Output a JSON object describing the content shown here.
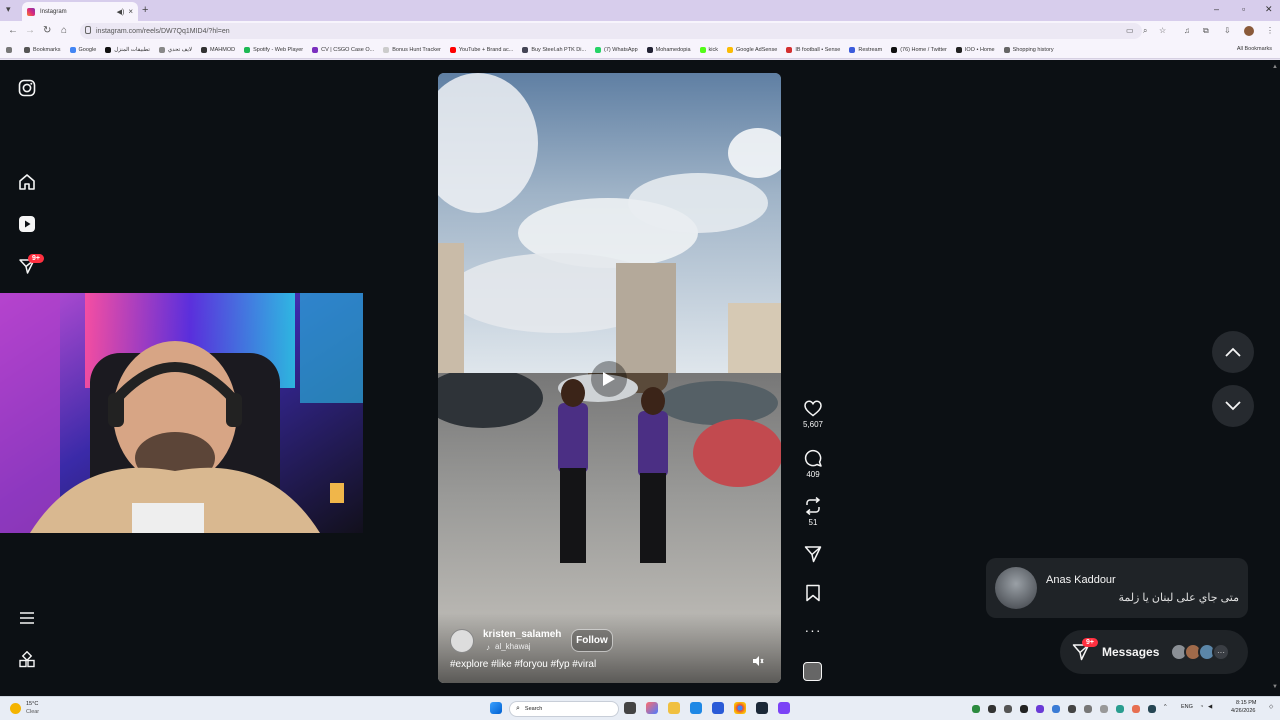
{
  "browser": {
    "tab_title": "Instagram",
    "url": "instagram.com/reels/DW7Qq1MID4/?hl=en",
    "bookmarks": [
      "Bookmarks",
      "Google",
      "تطبيقات المنزل",
      "لايف تحدي",
      "MAHMOD",
      "Spotify - Web Player",
      "CV | CSGO Case O...",
      "Bonus Hunt Tracker",
      "YouTube + Brand ac...",
      "Buy Steel.ah PTK Di...",
      "(7) WhatsApp",
      "Mohamedopia",
      "kick",
      "Google AdSense",
      "IB football • Sense",
      "Restream",
      "(76) Home / Twitter",
      "IOO • Home",
      "Shopping history"
    ],
    "all_bookmarks": "All Bookmarks"
  },
  "sidebar": {
    "notification_badge": "9+"
  },
  "reel": {
    "username": "kristen_salameh",
    "audio": "al_khawaj",
    "follow_label": "Follow",
    "caption": "#explore #like #foryou #fyp #viral"
  },
  "actions": {
    "likes": "5,607",
    "comments": "409",
    "reposts": "51"
  },
  "notification": {
    "name": "Anas Kaddour",
    "message": "متى جاي على لبنان يا زلمة"
  },
  "messages": {
    "label": "Messages",
    "badge": "9+"
  },
  "taskbar": {
    "weather_temp": "15°C",
    "weather_desc": "Clear",
    "search_placeholder": "Search",
    "lang": "ENG",
    "time": "8:15 PM",
    "date": "4/26/2026"
  }
}
